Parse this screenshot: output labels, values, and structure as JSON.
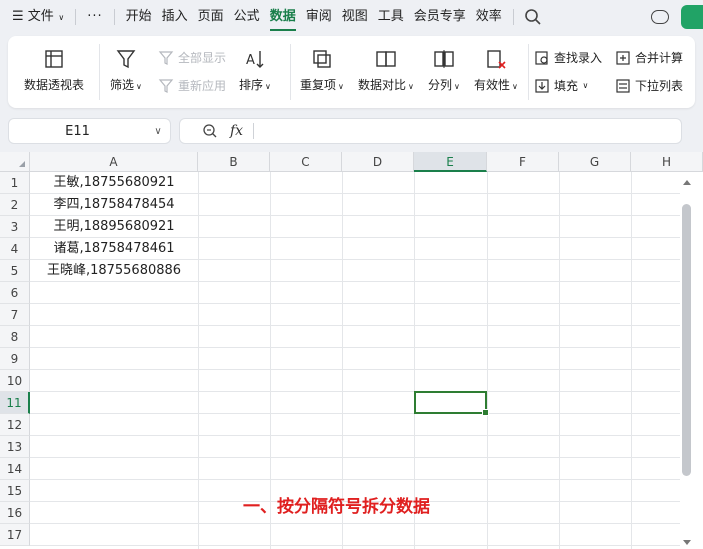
{
  "menubar": {
    "menu_icon": "hamburger-icon",
    "file_label": "文件",
    "more_label": "···",
    "tabs": [
      "开始",
      "插入",
      "页面",
      "公式",
      "数据",
      "审阅",
      "视图",
      "工具",
      "会员专享",
      "效率"
    ],
    "active_tab": "数据"
  },
  "ribbon": {
    "pivot": "数据透视表",
    "filter": "筛选",
    "show_all": "全部显示",
    "reapply": "重新应用",
    "sort": "排序",
    "duplicates": "重复项",
    "compare": "数据对比",
    "split": "分列",
    "validity": "有效性",
    "find_entry": "查找录入",
    "fill": "填充",
    "merge_calc": "合并计算",
    "dropdown_list": "下拉列表"
  },
  "formula_bar": {
    "cell_ref": "E11",
    "fx": "fx",
    "value": ""
  },
  "sheet": {
    "columns": [
      "A",
      "B",
      "C",
      "D",
      "E",
      "F",
      "G",
      "H"
    ],
    "active_column": "E",
    "rows": [
      "1",
      "2",
      "3",
      "4",
      "5",
      "6",
      "7",
      "8",
      "9",
      "10",
      "11",
      "12",
      "13",
      "14",
      "15",
      "16",
      "17"
    ],
    "active_row": "11",
    "cells_a": [
      "王敏,18755680921",
      "李四,18758478454",
      "王明,18895680921",
      "诸葛,18758478461",
      "王晓峰,18755680886"
    ]
  },
  "annotation": "一、按分隔符号拆分数据",
  "colors": {
    "accent": "#1a7f4b",
    "annotation": "#e02020",
    "selection": "#2e7d32"
  }
}
